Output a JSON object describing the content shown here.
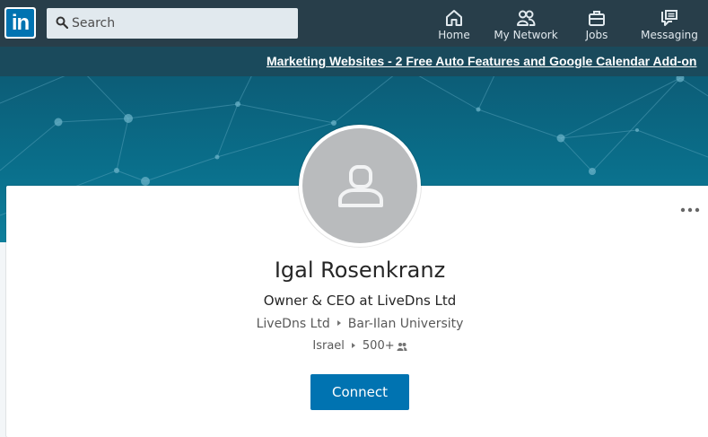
{
  "nav": {
    "logo_text": "in",
    "search_placeholder": "Search",
    "items": [
      {
        "label": "Home",
        "icon": "home-icon"
      },
      {
        "label": "My Network",
        "icon": "network-icon"
      },
      {
        "label": "Jobs",
        "icon": "briefcase-icon"
      },
      {
        "label": "Messaging",
        "icon": "messaging-icon"
      }
    ]
  },
  "ad": {
    "text": "Marketing Websites - 2 Free Auto Features and Google Calendar Add-on"
  },
  "profile": {
    "name": "Igal Rosenkranz",
    "headline": "Owner & CEO at LiveDns Ltd",
    "company": "LiveDns Ltd",
    "school": "Bar-Ilan University",
    "location": "Israel",
    "connections": "500+",
    "connect_label": "Connect",
    "more_icon": "more-icon",
    "avatar_icon": "person-placeholder-icon"
  },
  "colors": {
    "nav_bg": "#283e4a",
    "brand_blue": "#0073b1",
    "ad_bg": "#1a4a5c",
    "banner": "#0a6f8b"
  }
}
